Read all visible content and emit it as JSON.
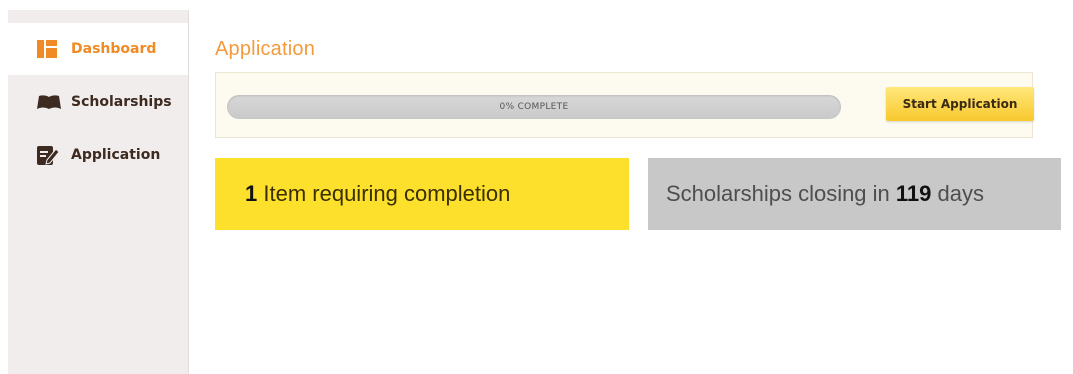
{
  "sidebar": {
    "items": [
      {
        "label": "Dashboard",
        "icon": "dashboard-icon",
        "active": true
      },
      {
        "label": "Scholarships",
        "icon": "book-icon",
        "active": false
      },
      {
        "label": "Application",
        "icon": "edit-icon",
        "active": false
      }
    ]
  },
  "main": {
    "title": "Application",
    "progress": {
      "percent": 0,
      "text": "0% COMPLETE"
    },
    "start_button": "Start Application",
    "cards": {
      "items_count": "1",
      "items_text": "Item requiring completion",
      "closing_prefix": "Scholarships closing in",
      "closing_days": "119",
      "closing_suffix": "days"
    }
  },
  "colors": {
    "accent": "#f08a24",
    "progress_bg": "#cfcfcf",
    "button": "#f8c92e",
    "card_yellow": "#fde02c",
    "card_grey": "#c8c8c8"
  }
}
